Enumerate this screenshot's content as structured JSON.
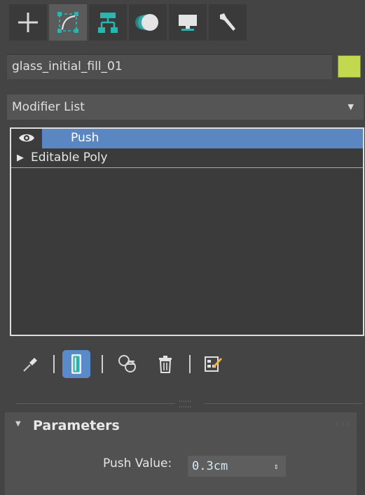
{
  "command_panel": {
    "tabs": [
      {
        "name": "create",
        "icon": "plus-icon"
      },
      {
        "name": "modify",
        "icon": "modify-curve-icon",
        "active": true
      },
      {
        "name": "hierarchy",
        "icon": "hierarchy-icon"
      },
      {
        "name": "motion",
        "icon": "motion-icon"
      },
      {
        "name": "display",
        "icon": "display-monitor-icon"
      },
      {
        "name": "utilities",
        "icon": "wrench-icon"
      }
    ]
  },
  "object": {
    "name": "glass_initial_fill_01",
    "color": "#c2d94f"
  },
  "modifier_list": {
    "label": "Modifier List"
  },
  "stack": {
    "items": [
      {
        "label": "Push",
        "selected": true,
        "visible": true
      },
      {
        "label": "Editable Poly",
        "selected": false
      }
    ]
  },
  "stack_toolbar": {
    "buttons": [
      "pin-stack-icon",
      "show-end-result-icon",
      "make-unique-icon",
      "remove-modifier-icon",
      "configure-modifier-sets-icon"
    ]
  },
  "parameters": {
    "title": "Parameters",
    "push_value_label": "Push Value:",
    "push_value": "0.3cm"
  },
  "colors": {
    "accent": "#5a86c1",
    "panel": "#444444",
    "tab_active": "#5b5b5b",
    "icon_teal": "#28b6b0"
  }
}
